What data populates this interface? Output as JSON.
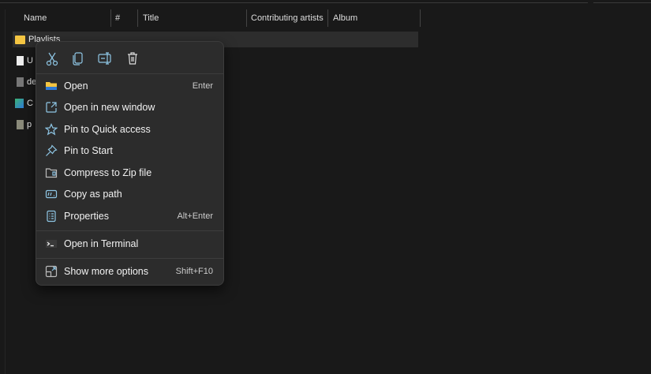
{
  "columns": [
    "Name",
    "#",
    "Title",
    "Contributing artists",
    "Album"
  ],
  "files": [
    {
      "name": "Playlists",
      "icon": "folder-icon",
      "selected": true
    },
    {
      "name": "U",
      "icon": "document-icon"
    },
    {
      "name": "de",
      "icon": "archive-icon"
    },
    {
      "name": "C",
      "icon": "media-file-icon"
    },
    {
      "name": "p",
      "icon": "package-icon"
    }
  ],
  "toolbar": [
    "cut",
    "copy",
    "rename",
    "delete"
  ],
  "menu": {
    "items": [
      {
        "label": "Open",
        "shortcut": "Enter",
        "icon": "folder-open-icon"
      },
      {
        "label": "Open in new window",
        "shortcut": "",
        "icon": "open-new-window-icon"
      },
      {
        "label": "Pin to Quick access",
        "shortcut": "",
        "icon": "star-icon"
      },
      {
        "label": "Pin to Start",
        "shortcut": "",
        "icon": "pin-icon"
      },
      {
        "label": "Compress to Zip file",
        "shortcut": "",
        "icon": "zip-icon"
      },
      {
        "label": "Copy as path",
        "shortcut": "",
        "icon": "copy-path-icon"
      },
      {
        "label": "Properties",
        "shortcut": "Alt+Enter",
        "icon": "properties-icon"
      }
    ],
    "terminal": {
      "label": "Open in Terminal",
      "icon": "terminal-icon"
    },
    "more": {
      "label": "Show more options",
      "shortcut": "Shift+F10",
      "icon": "more-options-icon"
    }
  },
  "colors": {
    "background": "#191919",
    "menu": "#2c2c2c",
    "accent": "#60cdff",
    "folder": "#f4c542"
  }
}
